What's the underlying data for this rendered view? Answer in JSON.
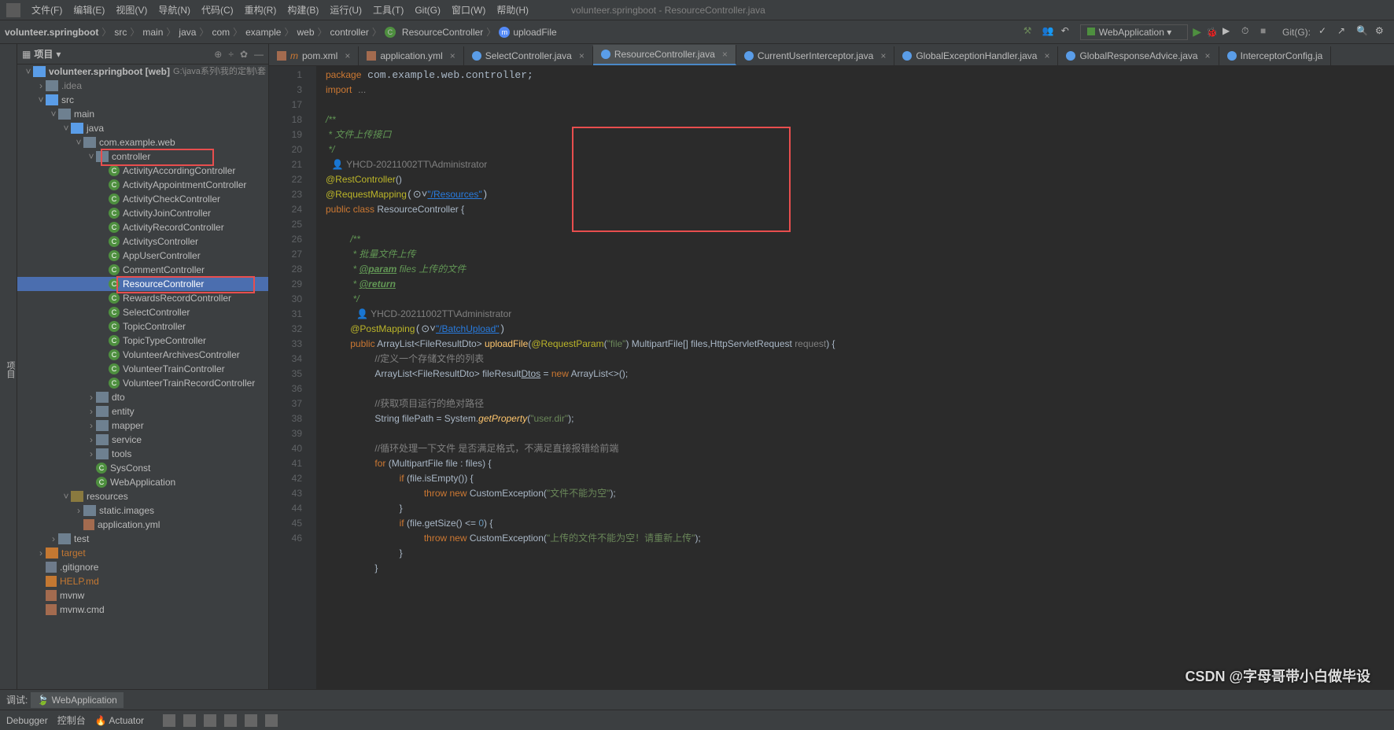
{
  "window_title": "volunteer.springboot - ResourceController.java",
  "menu": [
    "文件(F)",
    "编辑(E)",
    "视图(V)",
    "导航(N)",
    "代码(C)",
    "重构(R)",
    "构建(B)",
    "运行(U)",
    "工具(T)",
    "Git(G)",
    "窗口(W)",
    "帮助(H)"
  ],
  "breadcrumbs": [
    "volunteer.springboot",
    "src",
    "main",
    "java",
    "com",
    "example",
    "web",
    "controller",
    "ResourceController",
    "uploadFile"
  ],
  "run_config": "WebApplication",
  "git_label": "Git(G):",
  "project_panel": {
    "title": "项目",
    "icons": [
      "⊕",
      "÷",
      "✿",
      "—"
    ]
  },
  "tree": {
    "root": "volunteer.springboot [web]",
    "root_path": "G:\\java系列\\我的定制\\套",
    "idea": ".idea",
    "src": "src",
    "main": "main",
    "java": "java",
    "pkg": "com.example.web",
    "controller": "controller",
    "controllers": [
      "ActivityAccordingController",
      "ActivityAppointmentController",
      "ActivityCheckController",
      "ActivityJoinController",
      "ActivityRecordController",
      "ActivitysController",
      "AppUserController",
      "CommentController",
      "ResourceController",
      "RewardsRecordController",
      "SelectController",
      "TopicController",
      "TopicTypeController",
      "VolunteerArchivesController",
      "VolunteerTrainController",
      "VolunteerTrainRecordController"
    ],
    "dto": "dto",
    "entity": "entity",
    "mapper": "mapper",
    "service": "service",
    "tools": "tools",
    "sysconst": "SysConst",
    "webapp": "WebApplication",
    "resources": "resources",
    "static": "static.images",
    "appyml": "application.yml",
    "test": "test",
    "target": "target",
    "gitignore": ".gitignore",
    "help": "HELP.md",
    "mvnw": "mvnw",
    "mvnwcmd": "mvnw.cmd"
  },
  "tabs": [
    {
      "label": "pom.xml",
      "icon": "m"
    },
    {
      "label": "application.yml",
      "icon": "y"
    },
    {
      "label": "SelectController.java",
      "icon": "j"
    },
    {
      "label": "ResourceController.java",
      "icon": "j",
      "active": true
    },
    {
      "label": "CurrentUserInterceptor.java",
      "icon": "j"
    },
    {
      "label": "GlobalExceptionHandler.java",
      "icon": "j"
    },
    {
      "label": "GlobalResponseAdvice.java",
      "icon": "j"
    },
    {
      "label": "InterceptorConfig.ja",
      "icon": "j"
    }
  ],
  "lines": [
    "1",
    "3",
    "17",
    "18",
    "19",
    "20",
    "",
    "21",
    "22",
    "23",
    "24",
    "25",
    "26",
    "27",
    "28",
    "29",
    "",
    "30",
    "31",
    "32",
    "33",
    "34",
    "35",
    "36",
    "37",
    "38",
    "39",
    "40",
    "41",
    "42",
    "43",
    "44",
    "45",
    "46"
  ],
  "code": {
    "pkg": "package com.example.web.controller;",
    "imp": "import ...",
    "c1": "/**",
    "c2": " * 文件上传接口",
    "c3": " */",
    "auth1": "👤 YHCD-20211002TT\\Administrator",
    "rc": "@RestController",
    "rcp": "()",
    "rm": "@RequestMapping",
    "rmp": "\"/Resources\"",
    "cls1": "public class ",
    "cls2": "ResourceController ",
    "cls3": "{",
    "d1": "/**",
    "d2": " * 批量文件上传",
    "d3": " * ",
    "d3a": "@param",
    "d3b": " files 上传的文件",
    "d4": " * ",
    "d4a": "@return",
    "d5": " */",
    "auth2": "👤 YHCD-20211002TT\\Administrator",
    "pm": "@PostMapping",
    "pmp": "\"/BatchUpload\"",
    "m1": "public ",
    "m2": "ArrayList<FileResultDto> ",
    "m3": "uploadFile",
    "m4": "(",
    "m5": "@RequestParam",
    "m6": "(",
    "m7": "\"file\"",
    "m8": ") MultipartFile[] files,HttpServletRequest ",
    "m9": "request",
    "m10": ") {",
    "l1": "//定义一个存储文件的列表",
    "l2a": "ArrayList<FileResultDto> fileResult",
    "l2b": "Dtos",
    "l2c": " = ",
    "l2d": "new ",
    "l2e": "ArrayList<>();",
    "l3": "//获取项目运行的绝对路径",
    "l4a": "String filePath = System.",
    "l4b": "getProperty",
    "l4c": "(",
    "l4d": "\"user.dir\"",
    "l4e": ");",
    "l5": "//循环处理一下文件 是否满足格式，不满足直接报错给前端",
    "l6a": "for ",
    "l6b": "(MultipartFile file : files) {",
    "l7a": "if ",
    "l7b": "(file.isEmpty()) {",
    "l8a": "throw new ",
    "l8b": "CustomException(",
    "l8c": "\"文件不能为空\"",
    "l8d": ");",
    "l9": "}",
    "l10a": "if ",
    "l10b": "(file.getSize() <= ",
    "l10c": "0",
    "l10d": ") {",
    "l11a": "throw new ",
    "l11b": "CustomException(",
    "l11c": "\"上传的文件不能为空！请重新上传\"",
    "l11d": ");",
    "l12": "}",
    "l13": "}"
  },
  "status": {
    "debug": "调试:",
    "tabs": [
      "WebApplication"
    ],
    "bottom": [
      "Debugger",
      "控制台",
      "Actuator"
    ]
  },
  "watermark": "CSDN @字母哥带小白做毕设"
}
